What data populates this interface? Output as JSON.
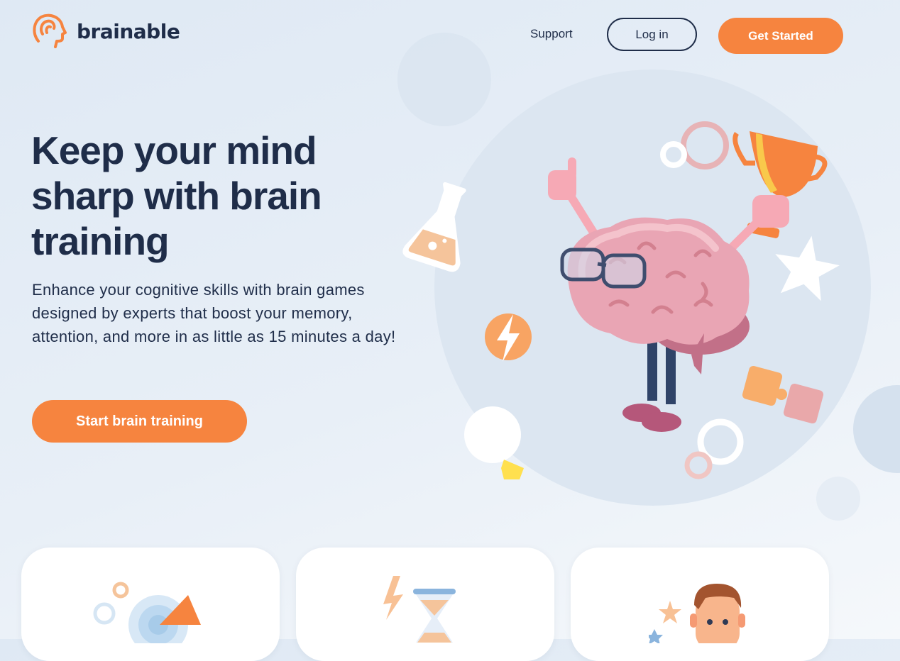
{
  "brand": {
    "name": "brainable",
    "logo_icon": "head-icon",
    "accent": "#f6843f",
    "dark": "#1f2d49"
  },
  "nav": {
    "support": "Support",
    "login": "Log in",
    "get_started": "Get Started"
  },
  "hero": {
    "title": "Keep your mind sharp with brain training",
    "description": "Enhance your cognitive skills with brain games designed by experts that boost your memory, attention, and more in as little as 15 minutes a day!",
    "cta": "Start brain training"
  },
  "illustration": {
    "icon": "brain-mascot-icon"
  },
  "cards": [
    {
      "icon": "target-icon"
    },
    {
      "icon": "hourglass-icon"
    },
    {
      "icon": "person-icon"
    }
  ]
}
